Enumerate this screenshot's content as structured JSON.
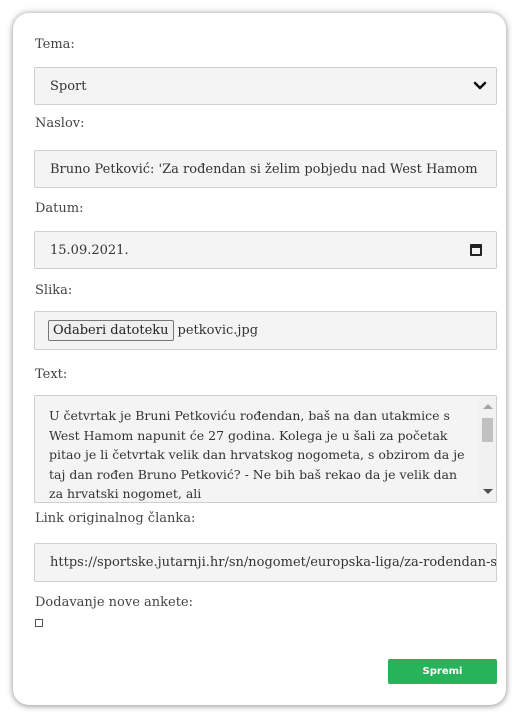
{
  "form": {
    "tema": {
      "label": "Tema:",
      "value": "Sport"
    },
    "naslov": {
      "label": "Naslov:",
      "value": "Bruno Petković: 'Za rođendan si želim pobjedu nad West Hamom"
    },
    "datum": {
      "label": "Datum:",
      "value": "15.09.2021."
    },
    "slika": {
      "label": "Slika:",
      "button_label": "Odaberi datoteku",
      "filename": "petkovic.jpg"
    },
    "text": {
      "label": "Text:",
      "value": "U četvrtak je Bruni Petkoviću rođendan, baš na dan utakmice s West Hamom napunit će 27 godina. Kolega je u šali za početak pitao je li četvrtak velik dan hrvatskog nogometa, s obzirom da je taj dan rođen Bruno Petković? - Ne bih baš rekao da je velik dan za hrvatski nogomet, ali"
    },
    "link": {
      "label": "Link originalnog članka:",
      "value": "https://sportske.jutarnji.hr/sn/nogomet/europska-liga/za-rodendan-si-zelim-pobjedu"
    },
    "anketa": {
      "label": "Dodavanje nove ankete:",
      "checked": false
    },
    "save_label": "Spremi"
  },
  "colors": {
    "save_button": "#27b35a",
    "field_background": "#f4f4f4"
  },
  "icons": {
    "select": "chevron-down-icon",
    "date": "calendar-icon"
  }
}
